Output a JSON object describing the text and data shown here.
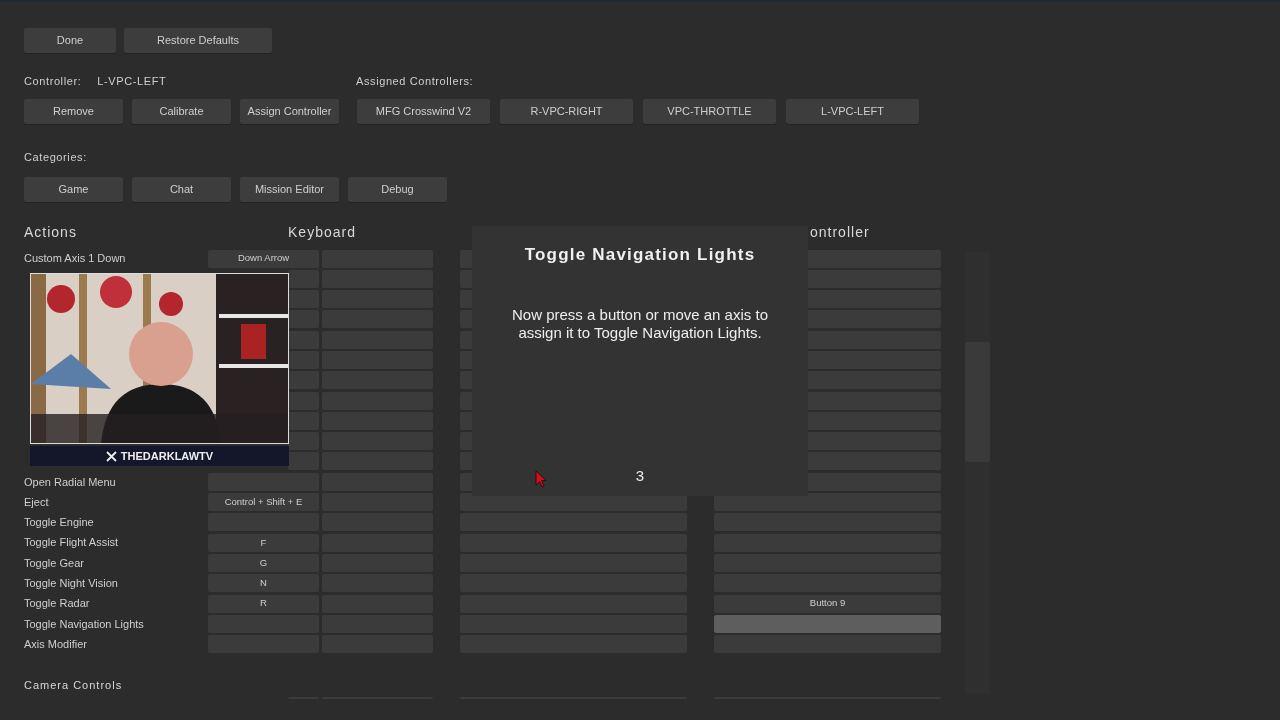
{
  "top_buttons": [
    "Done",
    "Restore Defaults"
  ],
  "controller": {
    "label": "Controller:",
    "value": "L-VPC-LEFT",
    "buttons": [
      "Remove",
      "Calibrate",
      "Assign Controller"
    ]
  },
  "assigned_controllers": {
    "label": "Assigned Controllers:",
    "items": [
      "MFG Crosswind V2",
      "R-VPC-RIGHT",
      "VPC-THROTTLE",
      "L-VPC-LEFT"
    ]
  },
  "categories": {
    "label": "Categories:",
    "items": [
      "Game",
      "Chat",
      "Mission Editor",
      "Debug"
    ]
  },
  "headers": {
    "actions": "Actions",
    "keyboard": "Keyboard",
    "controller": "ontroller"
  },
  "rows": [
    {
      "label": "Custom Axis 1 Down",
      "key_1": "Down Arrow",
      "listening": false
    },
    {
      "listening": false
    },
    {
      "listening": false
    },
    {
      "listening": false
    },
    {
      "listening": false
    },
    {
      "listening": false
    },
    {
      "listening": false
    },
    {
      "listening": false
    },
    {
      "listening": false
    },
    {
      "listening": false
    },
    {
      "listening": false
    },
    {
      "label": "Open Radial Menu",
      "listening": false
    },
    {
      "label": "Eject",
      "key_1": "Control + Shift + E",
      "listening": false
    },
    {
      "label": "Toggle Engine",
      "listening": false
    },
    {
      "label": "Toggle Flight Assist",
      "key_1": "F",
      "listening": false
    },
    {
      "label": "Toggle Gear",
      "key_1": "G",
      "listening": false
    },
    {
      "label": "Toggle Night Vision",
      "key_1": "N",
      "listening": false
    },
    {
      "label": "Toggle Radar",
      "key_1": "R",
      "controller_2": "Button 9",
      "listening": false
    },
    {
      "label": "Toggle Navigation Lights",
      "listening": true
    },
    {
      "label": "Axis Modifier",
      "listening": false
    }
  ],
  "camera_section": {
    "title": "Camera Controls",
    "rows": [
      {
        "listening": false
      }
    ]
  },
  "dialog": {
    "title": "Toggle Navigation Lights",
    "message": "Now press a button or move an axis to assign it to Toggle Navigation Lights.",
    "countdown": "3"
  },
  "webcam": {
    "kind": "picture",
    "caption": "THEDARKLAWTV"
  }
}
